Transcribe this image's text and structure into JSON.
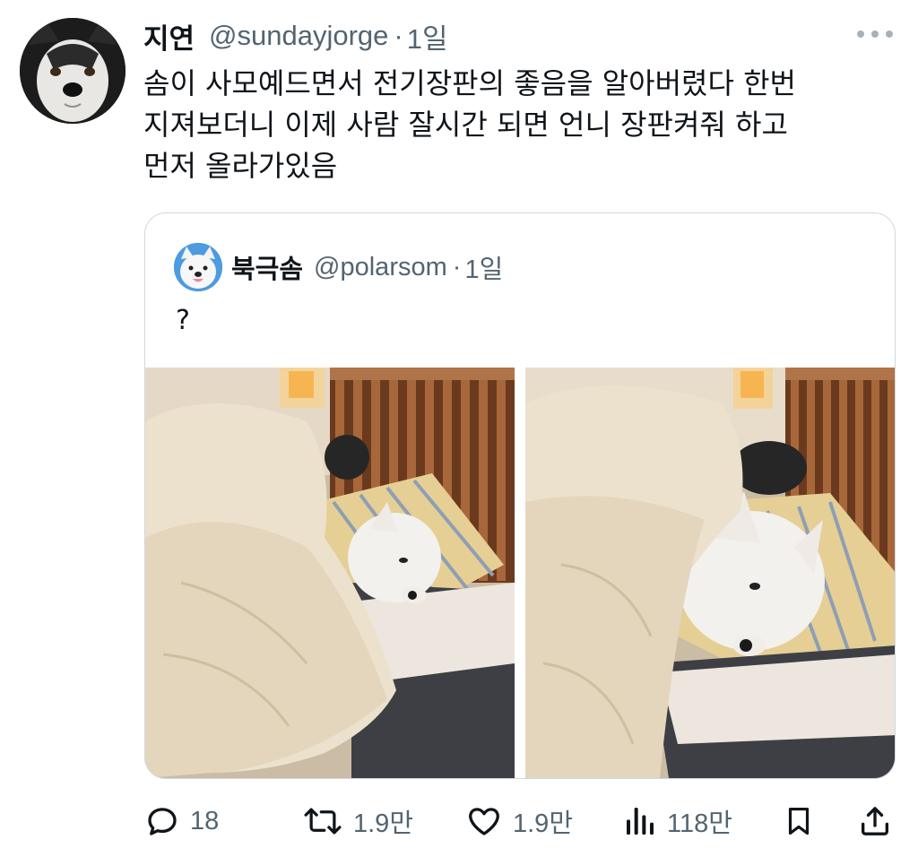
{
  "tweet": {
    "display_name": "지연",
    "handle": "@sundayjorge",
    "separator": "·",
    "time": "1일",
    "text_lines": [
      "솜이 사모예드면서 전기장판의 좋음을 알아버렸다 한번",
      "지져보더니 이제 사람 잘시간 되면 언니 장판켜줘 하고",
      "먼저 올라가있음"
    ]
  },
  "quote": {
    "display_name": "북극솜",
    "handle": "@polarsom",
    "separator": "·",
    "time": "1일",
    "text": "?"
  },
  "actions": {
    "replies": "18",
    "retweets": "1.9만",
    "likes": "1.9만",
    "views": "118만"
  },
  "icons": {
    "reply": "reply-icon",
    "retweet": "retweet-icon",
    "like": "heart-icon",
    "views": "views-icon",
    "bookmark": "bookmark-icon",
    "share": "share-icon",
    "more": "more-icon"
  },
  "colors": {
    "text": "#0f1419",
    "secondary": "#536471",
    "border": "#cfd9de"
  }
}
